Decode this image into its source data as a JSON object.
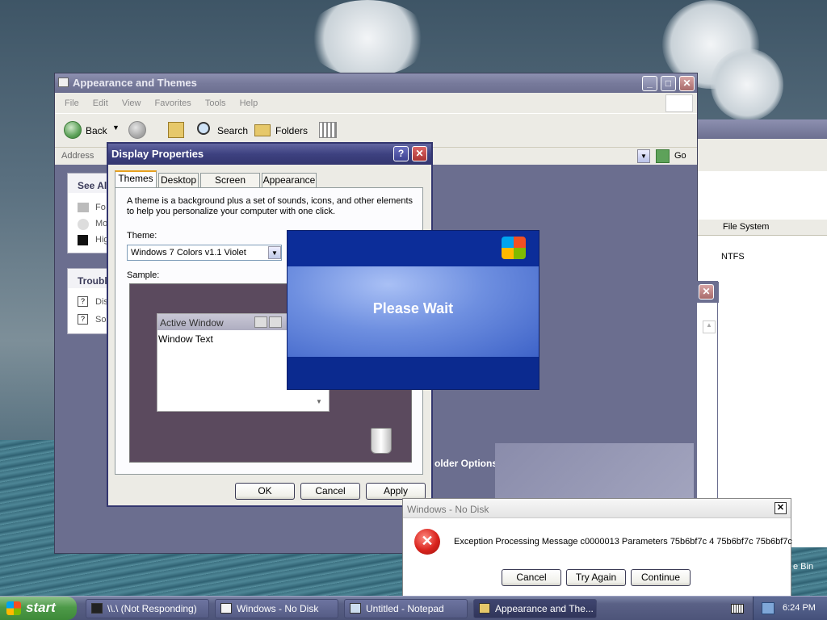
{
  "explorer": {
    "title": "Appearance and Themes",
    "menu": [
      "File",
      "Edit",
      "View",
      "Favorites",
      "Tools",
      "Help"
    ],
    "toolbar": {
      "back": "Back",
      "search": "Search",
      "folders": "Folders",
      "go": "Go"
    },
    "address_label": "Address",
    "see_also": "See Als",
    "see_also_items": [
      "Fo",
      "Mo",
      "Hig"
    ],
    "troubleshoot": "Troubl",
    "troubleshoot_items": [
      "Dis",
      "So"
    ],
    "folder_options": "older Options"
  },
  "background_window": {
    "column_header": "File System",
    "value": "NTFS"
  },
  "display_properties": {
    "title": "Display Properties",
    "tabs": [
      "Themes",
      "Desktop",
      "Screen Saver",
      "Appearance"
    ],
    "description": "A theme is a background plus a set of sounds, icons, and other elements to help you personalize your computer with one click.",
    "theme_label": "Theme:",
    "theme_value": "Windows 7 Colors v1.1 Violet",
    "sample_label": "Sample:",
    "sample_window_title": "Active Window",
    "sample_window_text": "Window Text",
    "buttons": {
      "ok": "OK",
      "cancel": "Cancel",
      "apply": "Apply"
    }
  },
  "splash": {
    "message": "Please Wait"
  },
  "error_dialog": {
    "title": "Windows - No Disk",
    "message": "Exception Processing Message c0000013 Parameters 75b6bf7c 4 75b6bf7c 75b6bf7c",
    "buttons": {
      "cancel": "Cancel",
      "try_again": "Try Again",
      "continue": "Continue"
    }
  },
  "desktop": {
    "recycle_label": "e Bin"
  },
  "taskbar": {
    "start": "start",
    "tasks": [
      {
        "label": "\\\\.\\ (Not Responding)"
      },
      {
        "label": "Windows - No Disk"
      },
      {
        "label": "Untitled - Notepad"
      },
      {
        "label": "Appearance and The..."
      }
    ],
    "clock": "6:24 PM"
  }
}
